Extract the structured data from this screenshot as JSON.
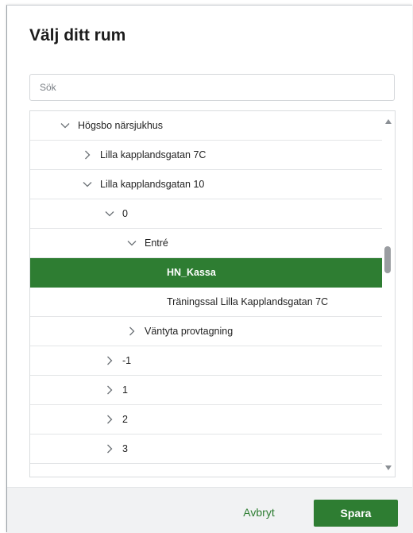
{
  "dialog": {
    "title": "Välj ditt rum",
    "search_placeholder": "Sök"
  },
  "tree": {
    "items": [
      {
        "label": "Högsbo närsjukhus",
        "level": 0,
        "expanded": true,
        "has_children": true,
        "selected": false
      },
      {
        "label": "Lilla kapplandsgatan 7C",
        "level": 1,
        "expanded": false,
        "has_children": true,
        "selected": false
      },
      {
        "label": "Lilla kapplandsgatan 10",
        "level": 1,
        "expanded": true,
        "has_children": true,
        "selected": false
      },
      {
        "label": "0",
        "level": 2,
        "expanded": true,
        "has_children": true,
        "selected": false
      },
      {
        "label": "Entré",
        "level": 3,
        "expanded": true,
        "has_children": true,
        "selected": false
      },
      {
        "label": "HN_Kassa",
        "level": 4,
        "expanded": false,
        "has_children": false,
        "selected": true
      },
      {
        "label": "Träningssal Lilla Kapplandsgatan 7C",
        "level": 4,
        "expanded": false,
        "has_children": false,
        "selected": false
      },
      {
        "label": "Väntyta provtagning",
        "level": 3,
        "expanded": false,
        "has_children": true,
        "selected": false
      },
      {
        "label": "-1",
        "level": 2,
        "expanded": false,
        "has_children": true,
        "selected": false
      },
      {
        "label": "1",
        "level": 2,
        "expanded": false,
        "has_children": true,
        "selected": false
      },
      {
        "label": "2",
        "level": 2,
        "expanded": false,
        "has_children": true,
        "selected": false
      },
      {
        "label": "3",
        "level": 2,
        "expanded": false,
        "has_children": true,
        "selected": false
      }
    ]
  },
  "footer": {
    "cancel_label": "Avbryt",
    "save_label": "Spara"
  },
  "colors": {
    "accent": "#2e7d32",
    "footer_bg": "#f1f2f3"
  }
}
